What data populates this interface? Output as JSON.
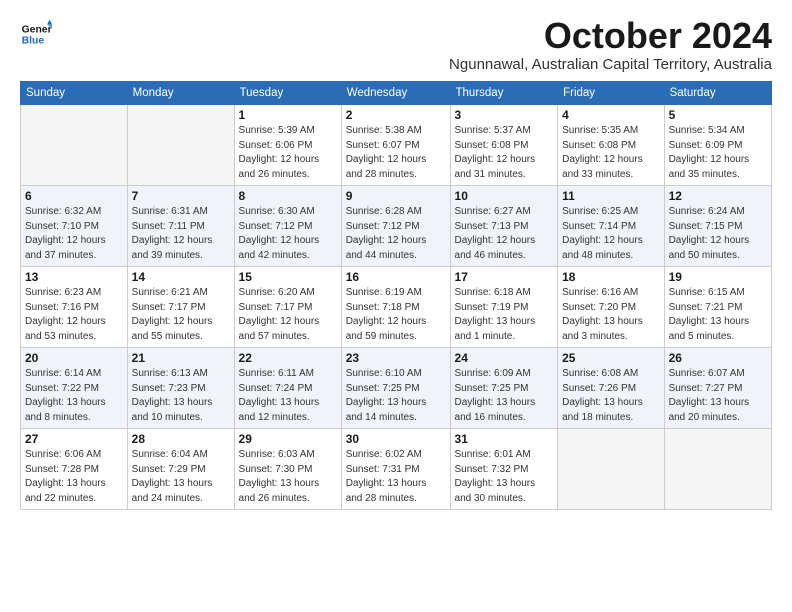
{
  "header": {
    "logo_line1": "General",
    "logo_line2": "Blue",
    "month": "October 2024",
    "location": "Ngunnawal, Australian Capital Territory, Australia"
  },
  "days_of_week": [
    "Sunday",
    "Monday",
    "Tuesday",
    "Wednesday",
    "Thursday",
    "Friday",
    "Saturday"
  ],
  "weeks": [
    [
      {
        "day": "",
        "info": ""
      },
      {
        "day": "",
        "info": ""
      },
      {
        "day": "1",
        "info": "Sunrise: 5:39 AM\nSunset: 6:06 PM\nDaylight: 12 hours\nand 26 minutes."
      },
      {
        "day": "2",
        "info": "Sunrise: 5:38 AM\nSunset: 6:07 PM\nDaylight: 12 hours\nand 28 minutes."
      },
      {
        "day": "3",
        "info": "Sunrise: 5:37 AM\nSunset: 6:08 PM\nDaylight: 12 hours\nand 31 minutes."
      },
      {
        "day": "4",
        "info": "Sunrise: 5:35 AM\nSunset: 6:08 PM\nDaylight: 12 hours\nand 33 minutes."
      },
      {
        "day": "5",
        "info": "Sunrise: 5:34 AM\nSunset: 6:09 PM\nDaylight: 12 hours\nand 35 minutes."
      }
    ],
    [
      {
        "day": "6",
        "info": "Sunrise: 6:32 AM\nSunset: 7:10 PM\nDaylight: 12 hours\nand 37 minutes."
      },
      {
        "day": "7",
        "info": "Sunrise: 6:31 AM\nSunset: 7:11 PM\nDaylight: 12 hours\nand 39 minutes."
      },
      {
        "day": "8",
        "info": "Sunrise: 6:30 AM\nSunset: 7:12 PM\nDaylight: 12 hours\nand 42 minutes."
      },
      {
        "day": "9",
        "info": "Sunrise: 6:28 AM\nSunset: 7:12 PM\nDaylight: 12 hours\nand 44 minutes."
      },
      {
        "day": "10",
        "info": "Sunrise: 6:27 AM\nSunset: 7:13 PM\nDaylight: 12 hours\nand 46 minutes."
      },
      {
        "day": "11",
        "info": "Sunrise: 6:25 AM\nSunset: 7:14 PM\nDaylight: 12 hours\nand 48 minutes."
      },
      {
        "day": "12",
        "info": "Sunrise: 6:24 AM\nSunset: 7:15 PM\nDaylight: 12 hours\nand 50 minutes."
      }
    ],
    [
      {
        "day": "13",
        "info": "Sunrise: 6:23 AM\nSunset: 7:16 PM\nDaylight: 12 hours\nand 53 minutes."
      },
      {
        "day": "14",
        "info": "Sunrise: 6:21 AM\nSunset: 7:17 PM\nDaylight: 12 hours\nand 55 minutes."
      },
      {
        "day": "15",
        "info": "Sunrise: 6:20 AM\nSunset: 7:17 PM\nDaylight: 12 hours\nand 57 minutes."
      },
      {
        "day": "16",
        "info": "Sunrise: 6:19 AM\nSunset: 7:18 PM\nDaylight: 12 hours\nand 59 minutes."
      },
      {
        "day": "17",
        "info": "Sunrise: 6:18 AM\nSunset: 7:19 PM\nDaylight: 13 hours\nand 1 minute."
      },
      {
        "day": "18",
        "info": "Sunrise: 6:16 AM\nSunset: 7:20 PM\nDaylight: 13 hours\nand 3 minutes."
      },
      {
        "day": "19",
        "info": "Sunrise: 6:15 AM\nSunset: 7:21 PM\nDaylight: 13 hours\nand 5 minutes."
      }
    ],
    [
      {
        "day": "20",
        "info": "Sunrise: 6:14 AM\nSunset: 7:22 PM\nDaylight: 13 hours\nand 8 minutes."
      },
      {
        "day": "21",
        "info": "Sunrise: 6:13 AM\nSunset: 7:23 PM\nDaylight: 13 hours\nand 10 minutes."
      },
      {
        "day": "22",
        "info": "Sunrise: 6:11 AM\nSunset: 7:24 PM\nDaylight: 13 hours\nand 12 minutes."
      },
      {
        "day": "23",
        "info": "Sunrise: 6:10 AM\nSunset: 7:25 PM\nDaylight: 13 hours\nand 14 minutes."
      },
      {
        "day": "24",
        "info": "Sunrise: 6:09 AM\nSunset: 7:25 PM\nDaylight: 13 hours\nand 16 minutes."
      },
      {
        "day": "25",
        "info": "Sunrise: 6:08 AM\nSunset: 7:26 PM\nDaylight: 13 hours\nand 18 minutes."
      },
      {
        "day": "26",
        "info": "Sunrise: 6:07 AM\nSunset: 7:27 PM\nDaylight: 13 hours\nand 20 minutes."
      }
    ],
    [
      {
        "day": "27",
        "info": "Sunrise: 6:06 AM\nSunset: 7:28 PM\nDaylight: 13 hours\nand 22 minutes."
      },
      {
        "day": "28",
        "info": "Sunrise: 6:04 AM\nSunset: 7:29 PM\nDaylight: 13 hours\nand 24 minutes."
      },
      {
        "day": "29",
        "info": "Sunrise: 6:03 AM\nSunset: 7:30 PM\nDaylight: 13 hours\nand 26 minutes."
      },
      {
        "day": "30",
        "info": "Sunrise: 6:02 AM\nSunset: 7:31 PM\nDaylight: 13 hours\nand 28 minutes."
      },
      {
        "day": "31",
        "info": "Sunrise: 6:01 AM\nSunset: 7:32 PM\nDaylight: 13 hours\nand 30 minutes."
      },
      {
        "day": "",
        "info": ""
      },
      {
        "day": "",
        "info": ""
      }
    ]
  ]
}
